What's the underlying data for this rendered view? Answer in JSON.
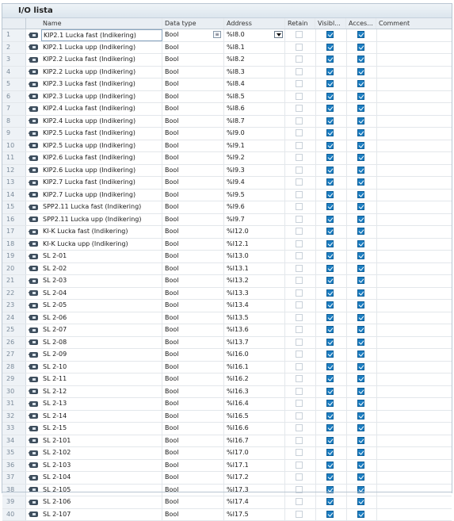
{
  "window": {
    "title": "I/O lista"
  },
  "columns": {
    "name": "Name",
    "data_type": "Data type",
    "address": "Address",
    "retain": "Retain",
    "visible": "Visibl...",
    "accessible": "Acces...",
    "comment": "Comment"
  },
  "rows": [
    {
      "num": "1",
      "name": "KIP2.1 Lucka fast (Indikering)",
      "type": "Bool",
      "address": "%I8.0",
      "retain": false,
      "visible": true,
      "accessible": true,
      "comment": ""
    },
    {
      "num": "2",
      "name": "KIP2.1 Lucka upp (Indikering)",
      "type": "Bool",
      "address": "%I8.1",
      "retain": false,
      "visible": true,
      "accessible": true,
      "comment": ""
    },
    {
      "num": "3",
      "name": "KIP2.2 Lucka fast (Indikering)",
      "type": "Bool",
      "address": "%I8.2",
      "retain": false,
      "visible": true,
      "accessible": true,
      "comment": ""
    },
    {
      "num": "4",
      "name": "KIP2.2 Lucka upp (Indikering)",
      "type": "Bool",
      "address": "%I8.3",
      "retain": false,
      "visible": true,
      "accessible": true,
      "comment": ""
    },
    {
      "num": "5",
      "name": "KIP2.3 Lucka fast (Indikering)",
      "type": "Bool",
      "address": "%I8.4",
      "retain": false,
      "visible": true,
      "accessible": true,
      "comment": ""
    },
    {
      "num": "6",
      "name": "KIP2.3 Lucka upp (Indikering)",
      "type": "Bool",
      "address": "%I8.5",
      "retain": false,
      "visible": true,
      "accessible": true,
      "comment": ""
    },
    {
      "num": "7",
      "name": "KIP2.4 Lucka fast (Indikering)",
      "type": "Bool",
      "address": "%I8.6",
      "retain": false,
      "visible": true,
      "accessible": true,
      "comment": ""
    },
    {
      "num": "8",
      "name": "KIP2.4 Lucka upp (Indikering)",
      "type": "Bool",
      "address": "%I8.7",
      "retain": false,
      "visible": true,
      "accessible": true,
      "comment": ""
    },
    {
      "num": "9",
      "name": "KIP2.5 Lucka fast (Indikering)",
      "type": "Bool",
      "address": "%I9.0",
      "retain": false,
      "visible": true,
      "accessible": true,
      "comment": ""
    },
    {
      "num": "10",
      "name": "KIP2.5 Lucka upp (Indikering)",
      "type": "Bool",
      "address": "%I9.1",
      "retain": false,
      "visible": true,
      "accessible": true,
      "comment": ""
    },
    {
      "num": "11",
      "name": "KIP2.6 Lucka fast (Indikering)",
      "type": "Bool",
      "address": "%I9.2",
      "retain": false,
      "visible": true,
      "accessible": true,
      "comment": ""
    },
    {
      "num": "12",
      "name": "KIP2.6 Lucka upp (Indikering)",
      "type": "Bool",
      "address": "%I9.3",
      "retain": false,
      "visible": true,
      "accessible": true,
      "comment": ""
    },
    {
      "num": "13",
      "name": "KIP2.7 Lucka fast (Indikering)",
      "type": "Bool",
      "address": "%I9.4",
      "retain": false,
      "visible": true,
      "accessible": true,
      "comment": ""
    },
    {
      "num": "14",
      "name": "KIP2.7 Lucka upp (Indikering)",
      "type": "Bool",
      "address": "%I9.5",
      "retain": false,
      "visible": true,
      "accessible": true,
      "comment": ""
    },
    {
      "num": "15",
      "name": "SPP2.11 Lucka fast (Indikering)",
      "type": "Bool",
      "address": "%I9.6",
      "retain": false,
      "visible": true,
      "accessible": true,
      "comment": ""
    },
    {
      "num": "16",
      "name": "SPP2.11 Lucka upp (Indikering)",
      "type": "Bool",
      "address": "%I9.7",
      "retain": false,
      "visible": true,
      "accessible": true,
      "comment": ""
    },
    {
      "num": "17",
      "name": "KI-K Lucka fast (Indikering)",
      "type": "Bool",
      "address": "%I12.0",
      "retain": false,
      "visible": true,
      "accessible": true,
      "comment": ""
    },
    {
      "num": "18",
      "name": "KI-K Lucka upp (Indikering)",
      "type": "Bool",
      "address": "%I12.1",
      "retain": false,
      "visible": true,
      "accessible": true,
      "comment": ""
    },
    {
      "num": "19",
      "name": "SL 2-01",
      "type": "Bool",
      "address": "%I13.0",
      "retain": false,
      "visible": true,
      "accessible": true,
      "comment": ""
    },
    {
      "num": "20",
      "name": "SL 2-02",
      "type": "Bool",
      "address": "%I13.1",
      "retain": false,
      "visible": true,
      "accessible": true,
      "comment": ""
    },
    {
      "num": "21",
      "name": "SL 2-03",
      "type": "Bool",
      "address": "%I13.2",
      "retain": false,
      "visible": true,
      "accessible": true,
      "comment": ""
    },
    {
      "num": "22",
      "name": "SL 2-04",
      "type": "Bool",
      "address": "%I13.3",
      "retain": false,
      "visible": true,
      "accessible": true,
      "comment": ""
    },
    {
      "num": "23",
      "name": "SL 2-05",
      "type": "Bool",
      "address": "%I13.4",
      "retain": false,
      "visible": true,
      "accessible": true,
      "comment": ""
    },
    {
      "num": "24",
      "name": "SL 2-06",
      "type": "Bool",
      "address": "%I13.5",
      "retain": false,
      "visible": true,
      "accessible": true,
      "comment": ""
    },
    {
      "num": "25",
      "name": "SL 2-07",
      "type": "Bool",
      "address": "%I13.6",
      "retain": false,
      "visible": true,
      "accessible": true,
      "comment": ""
    },
    {
      "num": "26",
      "name": "SL 2-08",
      "type": "Bool",
      "address": "%I13.7",
      "retain": false,
      "visible": true,
      "accessible": true,
      "comment": ""
    },
    {
      "num": "27",
      "name": "SL 2-09",
      "type": "Bool",
      "address": "%I16.0",
      "retain": false,
      "visible": true,
      "accessible": true,
      "comment": ""
    },
    {
      "num": "28",
      "name": "SL 2-10",
      "type": "Bool",
      "address": "%I16.1",
      "retain": false,
      "visible": true,
      "accessible": true,
      "comment": ""
    },
    {
      "num": "29",
      "name": "SL 2-11",
      "type": "Bool",
      "address": "%I16.2",
      "retain": false,
      "visible": true,
      "accessible": true,
      "comment": ""
    },
    {
      "num": "30",
      "name": "SL 2-12",
      "type": "Bool",
      "address": "%I16.3",
      "retain": false,
      "visible": true,
      "accessible": true,
      "comment": ""
    },
    {
      "num": "31",
      "name": "SL 2-13",
      "type": "Bool",
      "address": "%I16.4",
      "retain": false,
      "visible": true,
      "accessible": true,
      "comment": ""
    },
    {
      "num": "32",
      "name": "SL 2-14",
      "type": "Bool",
      "address": "%I16.5",
      "retain": false,
      "visible": true,
      "accessible": true,
      "comment": ""
    },
    {
      "num": "33",
      "name": "SL 2-15",
      "type": "Bool",
      "address": "%I16.6",
      "retain": false,
      "visible": true,
      "accessible": true,
      "comment": ""
    },
    {
      "num": "34",
      "name": "SL 2-101",
      "type": "Bool",
      "address": "%I16.7",
      "retain": false,
      "visible": true,
      "accessible": true,
      "comment": ""
    },
    {
      "num": "35",
      "name": "SL 2-102",
      "type": "Bool",
      "address": "%I17.0",
      "retain": false,
      "visible": true,
      "accessible": true,
      "comment": ""
    },
    {
      "num": "36",
      "name": "SL 2-103",
      "type": "Bool",
      "address": "%I17.1",
      "retain": false,
      "visible": true,
      "accessible": true,
      "comment": ""
    },
    {
      "num": "37",
      "name": "SL 2-104",
      "type": "Bool",
      "address": "%I17.2",
      "retain": false,
      "visible": true,
      "accessible": true,
      "comment": ""
    },
    {
      "num": "38",
      "name": "SL 2-105",
      "type": "Bool",
      "address": "%I17.3",
      "retain": false,
      "visible": true,
      "accessible": true,
      "comment": ""
    },
    {
      "num": "39",
      "name": "SL 2-106",
      "type": "Bool",
      "address": "%I17.4",
      "retain": false,
      "visible": true,
      "accessible": true,
      "comment": ""
    },
    {
      "num": "40",
      "name": "SL 2-107",
      "type": "Bool",
      "address": "%I17.5",
      "retain": false,
      "visible": true,
      "accessible": true,
      "comment": ""
    }
  ],
  "editing_row": 0,
  "icons": {
    "tag": "plc-tag-icon",
    "type_picker": "list-icon",
    "address_dropdown": "chevron-down-icon"
  },
  "colors": {
    "checkbox_checked": "#1b7ec2",
    "header_bg": "#e9eef3",
    "row_num_bg": "#eef2f6"
  }
}
